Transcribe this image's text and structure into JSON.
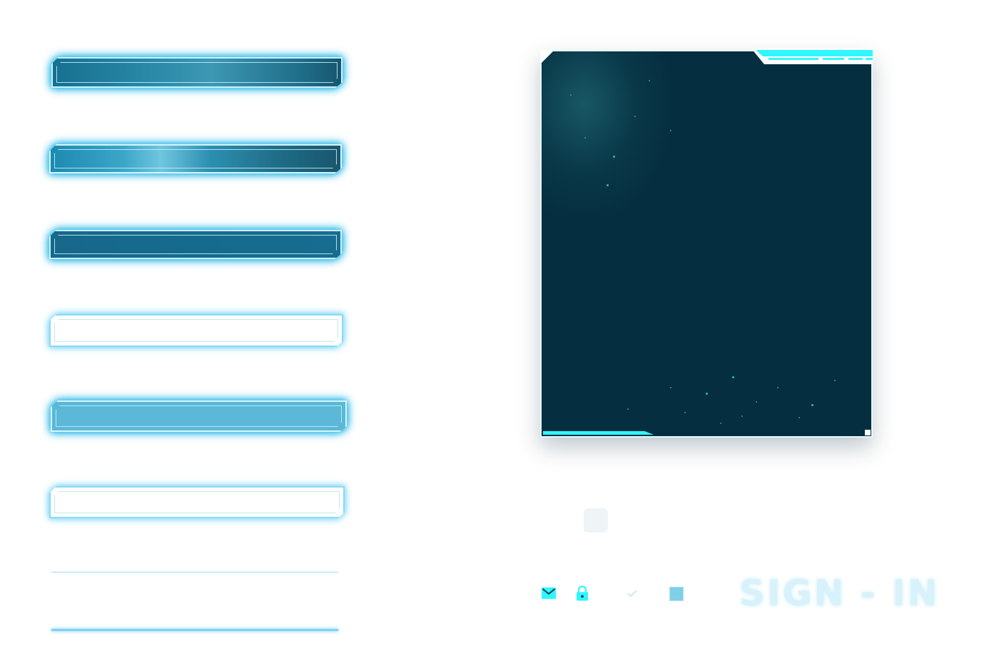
{
  "assets": {
    "bars": [
      {
        "name": "bar-gradient-1",
        "style": "filled-gradient",
        "color": "#2a8aa8"
      },
      {
        "name": "bar-gradient-2",
        "style": "filled-gradient-highlight",
        "color": "#3aa6c8"
      },
      {
        "name": "bar-solid-dark",
        "style": "filled-solid",
        "color": "#156b8d"
      },
      {
        "name": "bar-hollow-1",
        "style": "outline",
        "color": "#8fd8f2"
      },
      {
        "name": "bar-solid-light",
        "style": "filled-solid",
        "color": "#5bb8d6"
      },
      {
        "name": "bar-hollow-2",
        "style": "outline",
        "color": "#8fd8f2"
      }
    ],
    "lines": [
      {
        "name": "divider-thin",
        "color": "#9bdcf2"
      },
      {
        "name": "divider-glow",
        "color": "#7fd3f3"
      }
    ]
  },
  "panel": {
    "background_color": "#052f40",
    "accent_color": "#2ff6ff",
    "border_color": "#e6f8fc"
  },
  "icons": [
    {
      "name": "mail-icon",
      "color": "#2ff6ff"
    },
    {
      "name": "lock-icon",
      "color": "#2ff6ff"
    },
    {
      "name": "check-icon",
      "color": "#bfe6f2"
    },
    {
      "name": "checkbox-icon",
      "color": "#7fcfe6"
    }
  ],
  "title": {
    "text": "SIGN - IN",
    "color": "#d8f2fb"
  }
}
